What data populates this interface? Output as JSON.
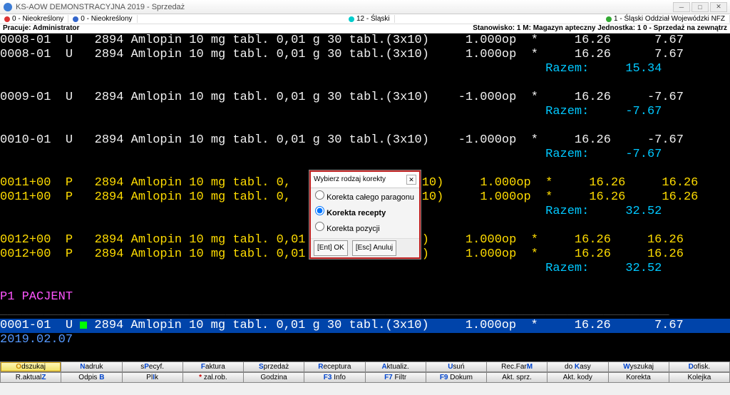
{
  "window": {
    "title": "KS-AOW DEMONSTRACYJNA 2019 - Sprzedaż"
  },
  "infobar": {
    "c1": "0 - Nieokreślony",
    "c2": "0 - Nieokreślony",
    "c3": "12 - Śląski",
    "c4": "1 - Śląski Oddział Wojewódzki NFZ"
  },
  "statusline": {
    "left": "Pracuje: Administrator",
    "right": "Stanowisko: 1  M: Magazyn apteczny  Jednostka: 1  0 - Sprzedaż na zewnątrz"
  },
  "lines": {
    "l1": "0008-01  U   2894 Amlopin 10 mg tabl. 0,01 g 30 tabl.(3x10)     1.000op  *     16.26      7.67",
    "l2": "0008-01  U   2894 Amlopin 10 mg tabl. 0,01 g 30 tabl.(3x10)     1.000op  *     16.26      7.67",
    "r1": "                                                                           Razem:     15.34",
    "l3": "0009-01  U   2894 Amlopin 10 mg tabl. 0,01 g 30 tabl.(3x10)    -1.000op  *     16.26     -7.67",
    "r2": "                                                                           Razem:     -7.67",
    "l4": "0010-01  U   2894 Amlopin 10 mg tabl. 0,01 g 30 tabl.(3x10)    -1.000op  *     16.26     -7.67",
    "r3": "                                                                           Razem:     -7.67",
    "l5a": "0011+00  P   2894 Amlopin 10 mg tabl. 0,",
    "l5b": "3x10)     1.000op  *     16.26     16.26",
    "l6a": "0011+00  P   2894 Amlopin 10 mg tabl. 0,",
    "l6b": "3x10)     1.000op  *     16.26     16.26",
    "r4": "                                                                           Razem:     32.52",
    "l7": "0012+00  P   2894 Amlopin 10 mg tabl. 0,01 g 30 tabl.(3x10)     1.000op  *     16.26     16.26",
    "l8": "0012+00  P   2894 Amlopin 10 mg tabl. 0,01 g 30 tabl.(3x10)     1.000op  *     16.26     16.26",
    "r5": "                                                                           Razem:     32.52",
    "patient": "P1 PACJENT",
    "dashline": "____________________________________________________________________________________________",
    "sel": "0001-01  U   2894 Amlopin 10 mg tabl. 0,01 g 30 tabl.(3x10)     1.000op  *     16.26      7.67",
    "date": "2019.02.07"
  },
  "dialog": {
    "title": "Wybierz rodzaj korekty",
    "opt1": "Korekta całego paragonu",
    "opt2": "Korekta recepty",
    "opt3": "Korekta pozycji",
    "ok": "[Ent] OK",
    "cancel": "[Esc] Anuluj"
  },
  "fkeys_row1": [
    "Odszukaj",
    "Nadruk",
    "sPecyf.",
    "Faktura",
    "Sprzedaż",
    "Receptura",
    "Aktualiz.",
    "Usuń",
    "Rec.FarM",
    "do Kasy",
    "Wyszukaj",
    "Dofisk."
  ],
  "fkeys_row2": [
    "R.aktualZ",
    "Odpis B",
    "PlIk",
    "zal.rob.",
    "Godzina",
    "F3 Info",
    "F7 Filtr",
    "F9 Dokum",
    "Akt. sprz.",
    "Akt. kody",
    "Korekta",
    "Kolejka"
  ]
}
